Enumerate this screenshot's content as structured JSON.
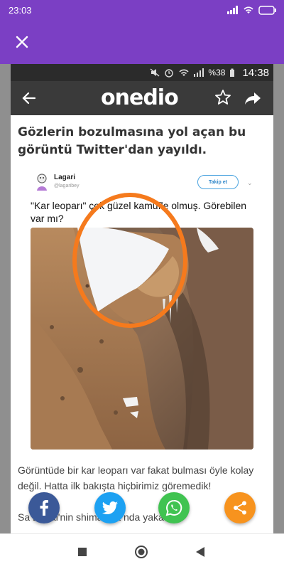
{
  "phone_status": {
    "time": "23:03"
  },
  "inner_status": {
    "battery": "%38",
    "time": "14:38"
  },
  "onedio": {
    "logo": "onedio"
  },
  "article": {
    "headline": "Gözlerin bozulmasına yol açan bu görüntü Twitter'dan yayıldı.",
    "paragraph1": "Görüntüde bir kar leoparı var fakat bulması öyle kolay değil. Hatta ilk bakışta hiçbirimiz göremedik!",
    "paragraph2_visible": "Sa       Desai'nin      shimalaya      nda yaka"
  },
  "tweet": {
    "name": "Lagari",
    "handle": "@lagaribey",
    "follow_label": "Takip et",
    "text": "\"Kar leoparı\" çok güzel kamufle olmuş. Görebilen var mı?"
  },
  "colors": {
    "appbar": "#7b3fc4",
    "facebook": "#3b5998",
    "twitter": "#1da1f2",
    "whatsapp": "#40c351",
    "share": "#f7931e",
    "highlight": "#f57a1d"
  },
  "icons": [
    "close-icon",
    "back-arrow-icon",
    "star-icon",
    "share-arrow-icon",
    "facebook-icon",
    "twitter-icon",
    "whatsapp-icon",
    "share-icon",
    "back-nav-icon",
    "home-nav-icon",
    "recents-nav-icon"
  ]
}
